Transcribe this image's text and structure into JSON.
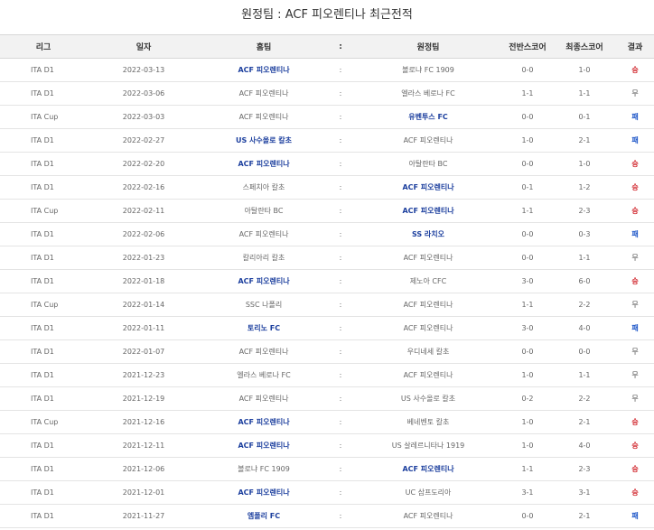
{
  "title": "원정팀 : ACF 피오렌티나 최근전적",
  "headers": {
    "league": "리그",
    "date": "일자",
    "home": "홈팀",
    "sep": ":",
    "away": "원정팀",
    "half": "전반스코어",
    "final": "최종스코어",
    "result": "결과"
  },
  "colors": {
    "team_highlight": "#1c3f9e",
    "win": "#d0232a",
    "loss": "#1c55c8"
  },
  "rows": [
    {
      "league": "ITA D1",
      "date": "2022-03-13",
      "home": "ACF 피오렌티나",
      "home_bold": true,
      "away": "볼로냐 FC 1909",
      "away_bold": false,
      "half": "0-0",
      "final": "1-0",
      "result": "승",
      "type": "win"
    },
    {
      "league": "ITA D1",
      "date": "2022-03-06",
      "home": "ACF 피오렌티나",
      "home_bold": false,
      "away": "엘라스 베로나 FC",
      "away_bold": false,
      "half": "1-1",
      "final": "1-1",
      "result": "무",
      "type": "draw"
    },
    {
      "league": "ITA Cup",
      "date": "2022-03-03",
      "home": "ACF 피오렌티나",
      "home_bold": false,
      "away": "유벤투스 FC",
      "away_bold": true,
      "half": "0-0",
      "final": "0-1",
      "result": "패",
      "type": "loss"
    },
    {
      "league": "ITA D1",
      "date": "2022-02-27",
      "home": "US 사수올로 칼초",
      "home_bold": true,
      "away": "ACF 피오렌티나",
      "away_bold": false,
      "half": "1-0",
      "final": "2-1",
      "result": "패",
      "type": "loss"
    },
    {
      "league": "ITA D1",
      "date": "2022-02-20",
      "home": "ACF 피오렌티나",
      "home_bold": true,
      "away": "아탈란타 BC",
      "away_bold": false,
      "half": "0-0",
      "final": "1-0",
      "result": "승",
      "type": "win"
    },
    {
      "league": "ITA D1",
      "date": "2022-02-16",
      "home": "스페치아 칼초",
      "home_bold": false,
      "away": "ACF 피오렌티나",
      "away_bold": true,
      "half": "0-1",
      "final": "1-2",
      "result": "승",
      "type": "win"
    },
    {
      "league": "ITA Cup",
      "date": "2022-02-11",
      "home": "아탈란타 BC",
      "home_bold": false,
      "away": "ACF 피오렌티나",
      "away_bold": true,
      "half": "1-1",
      "final": "2-3",
      "result": "승",
      "type": "win"
    },
    {
      "league": "ITA D1",
      "date": "2022-02-06",
      "home": "ACF 피오렌티나",
      "home_bold": false,
      "away": "SS 라치오",
      "away_bold": true,
      "half": "0-0",
      "final": "0-3",
      "result": "패",
      "type": "loss"
    },
    {
      "league": "ITA D1",
      "date": "2022-01-23",
      "home": "칼리아리 칼초",
      "home_bold": false,
      "away": "ACF 피오렌티나",
      "away_bold": false,
      "half": "0-0",
      "final": "1-1",
      "result": "무",
      "type": "draw"
    },
    {
      "league": "ITA D1",
      "date": "2022-01-18",
      "home": "ACF 피오렌티나",
      "home_bold": true,
      "away": "제노아 CFC",
      "away_bold": false,
      "half": "3-0",
      "final": "6-0",
      "result": "승",
      "type": "win"
    },
    {
      "league": "ITA Cup",
      "date": "2022-01-14",
      "home": "SSC 나폴리",
      "home_bold": false,
      "away": "ACF 피오렌티나",
      "away_bold": false,
      "half": "1-1",
      "final": "2-2",
      "result": "무",
      "type": "draw"
    },
    {
      "league": "ITA D1",
      "date": "2022-01-11",
      "home": "토리노 FC",
      "home_bold": true,
      "away": "ACF 피오렌티나",
      "away_bold": false,
      "half": "3-0",
      "final": "4-0",
      "result": "패",
      "type": "loss"
    },
    {
      "league": "ITA D1",
      "date": "2022-01-07",
      "home": "ACF 피오렌티나",
      "home_bold": false,
      "away": "우디네세 칼초",
      "away_bold": false,
      "half": "0-0",
      "final": "0-0",
      "result": "무",
      "type": "draw"
    },
    {
      "league": "ITA D1",
      "date": "2021-12-23",
      "home": "엘라스 베로나 FC",
      "home_bold": false,
      "away": "ACF 피오렌티나",
      "away_bold": false,
      "half": "1-0",
      "final": "1-1",
      "result": "무",
      "type": "draw"
    },
    {
      "league": "ITA D1",
      "date": "2021-12-19",
      "home": "ACF 피오렌티나",
      "home_bold": false,
      "away": "US 사수올로 칼초",
      "away_bold": false,
      "half": "0-2",
      "final": "2-2",
      "result": "무",
      "type": "draw"
    },
    {
      "league": "ITA Cup",
      "date": "2021-12-16",
      "home": "ACF 피오렌티나",
      "home_bold": true,
      "away": "베네벤토 칼초",
      "away_bold": false,
      "half": "1-0",
      "final": "2-1",
      "result": "승",
      "type": "win"
    },
    {
      "league": "ITA D1",
      "date": "2021-12-11",
      "home": "ACF 피오렌티나",
      "home_bold": true,
      "away": "US 살레르니타나 1919",
      "away_bold": false,
      "half": "1-0",
      "final": "4-0",
      "result": "승",
      "type": "win"
    },
    {
      "league": "ITA D1",
      "date": "2021-12-06",
      "home": "볼로냐 FC 1909",
      "home_bold": false,
      "away": "ACF 피오렌티나",
      "away_bold": true,
      "half": "1-1",
      "final": "2-3",
      "result": "승",
      "type": "win"
    },
    {
      "league": "ITA D1",
      "date": "2021-12-01",
      "home": "ACF 피오렌티나",
      "home_bold": true,
      "away": "UC 삼프도리아",
      "away_bold": false,
      "half": "3-1",
      "final": "3-1",
      "result": "승",
      "type": "win"
    },
    {
      "league": "ITA D1",
      "date": "2021-11-27",
      "home": "엠폴리 FC",
      "home_bold": true,
      "away": "ACF 피오렌티나",
      "away_bold": false,
      "half": "0-0",
      "final": "2-1",
      "result": "패",
      "type": "loss"
    }
  ]
}
